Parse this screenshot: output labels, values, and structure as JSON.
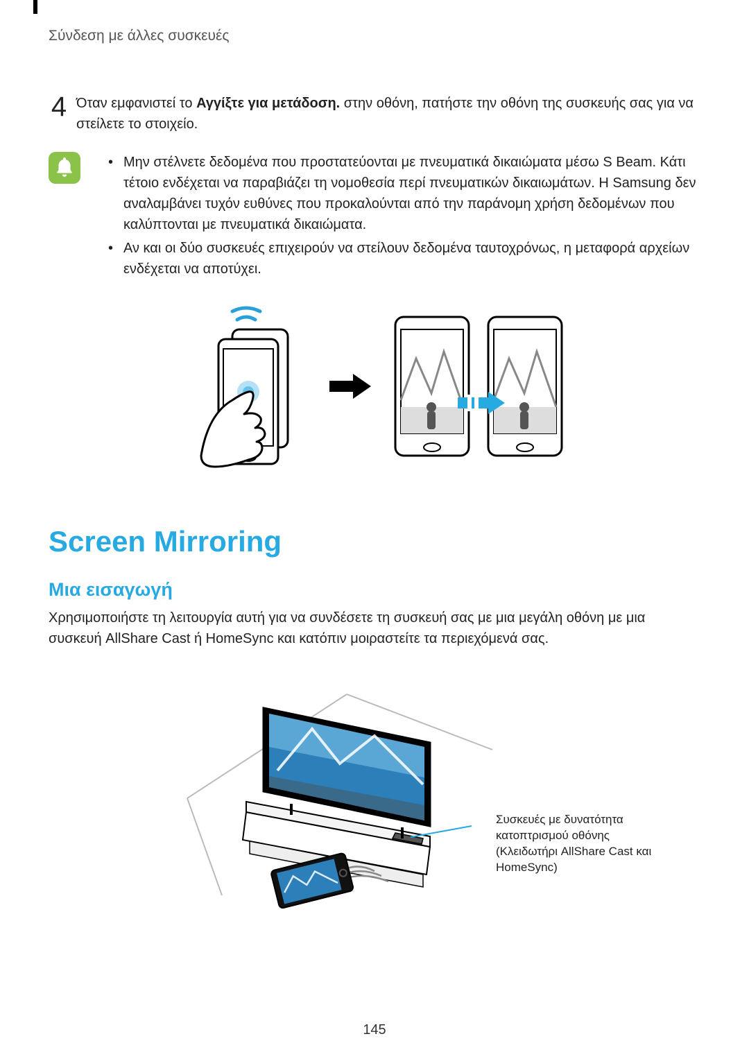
{
  "chapter_title": "Σύνδεση με άλλες συσκευές",
  "step": {
    "number": "4",
    "text_1": "Όταν εμφανιστεί το ",
    "bold": "Αγγίξτε για μετάδοση.",
    "text_2": " στην οθόνη, πατήστε την οθόνη της συσκευής σας για να στείλετε το στοιχείο."
  },
  "notes": [
    "Μην στέλνετε δεδομένα που προστατεύονται με πνευματικά δικαιώματα μέσω S Beam. Κάτι τέτοιο ενδέχεται να παραβιάζει τη νομοθεσία περί πνευματικών δικαιωμάτων. Η Samsung δεν αναλαμβάνει τυχόν ευθύνες που προκαλούνται από την παράνομη χρήση δεδομένων που καλύπτονται με πνευματικά δικαιώματα.",
    "Αν και οι δύο συσκευές επιχειρούν να στείλουν δεδομένα ταυτοχρόνως, η μεταφορά αρχείων ενδέχεται να αποτύχει."
  ],
  "section_heading": "Screen Mirroring",
  "subsection_heading": "Μια εισαγωγή",
  "intro_text": "Χρησιμοποιήστε τη λειτουργία αυτή για να συνδέσετε τη συσκευή σας με μια μεγάλη οθόνη με μια συσκευή AllShare Cast ή HomeSync και κατόπιν μοιραστείτε τα περιεχόμενά σας.",
  "callout_text": "Συσκευές με δυνατότητα κατοπτρισμού οθόνης (Κλειδωτήρι AllShare Cast και HomeSync)",
  "page_number": "145"
}
